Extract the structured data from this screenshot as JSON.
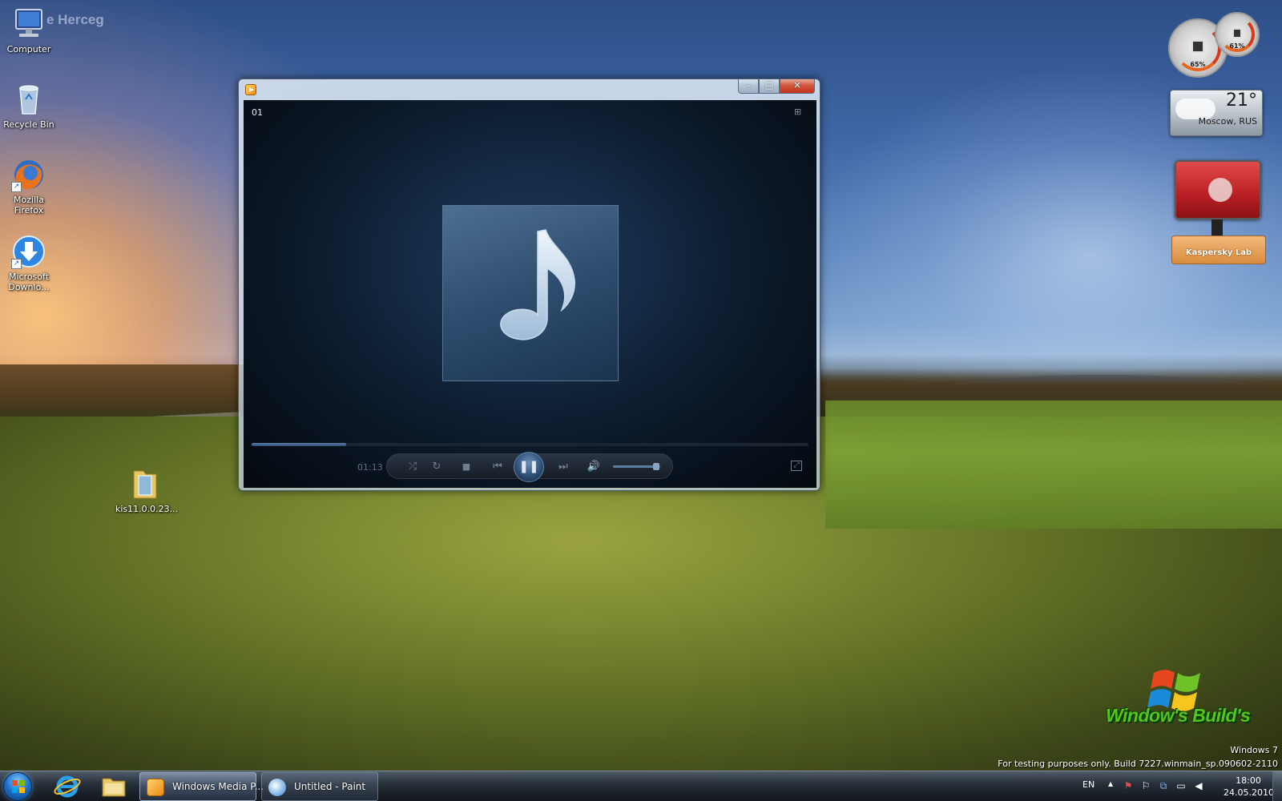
{
  "desktop": {
    "watermark_name": "e Herceg",
    "icons": [
      {
        "label": "Computer",
        "icon": "computer-icon"
      },
      {
        "label": "Recycle Bin",
        "icon": "recycle-bin-icon"
      },
      {
        "label": "Mozilla Firefox",
        "icon": "firefox-icon"
      },
      {
        "label": "Microsoft Downlo...",
        "icon": "download-icon"
      },
      {
        "label": "kis11.0.0.23...",
        "icon": "folder-icon"
      }
    ]
  },
  "media_player": {
    "track_label": "01",
    "elapsed_time": "01:13",
    "progress_fraction": 0.17,
    "volume_fraction": 0.9,
    "window_buttons": {
      "minimize": "–",
      "maximize": "□",
      "close": "✕"
    },
    "controls": {
      "shuffle": "⤮",
      "repeat": "↻",
      "stop": "■",
      "previous": "⏮",
      "play_pause": "❚❚",
      "next": "⏭",
      "mute": "🔊",
      "switch_view": "⊞",
      "fullscreen": "⤢"
    },
    "art_icon": "music-note-icon"
  },
  "gadgets": {
    "cpu_meter": {
      "cpu_percent": "65%",
      "ram_percent": "61%"
    },
    "weather": {
      "temperature": "21°",
      "location": "Moscow, RUS"
    },
    "kaspersky": {
      "label": "Kaspersky Lab"
    }
  },
  "branding": {
    "logo_text": "Window's Build's",
    "os_name": "Windows 7",
    "build_notice": "For testing purposes only. Build 7227.winmain_sp.090602-2110"
  },
  "taskbar": {
    "pinned": [
      {
        "name": "internet-explorer",
        "icon": "internet-explorer-icon"
      },
      {
        "name": "windows-explorer",
        "icon": "folder-icon"
      }
    ],
    "apps": [
      {
        "label": "Windows Media P...",
        "icon": "media-player-icon",
        "active": true
      },
      {
        "label": "Untitled - Paint",
        "icon": "paint-icon",
        "active": false
      }
    ],
    "tray": {
      "language": "EN",
      "show_hidden": "▲",
      "clock_time": "18:00",
      "clock_date": "24.05.2010"
    }
  },
  "colors": {
    "taskbar": "#1e2630",
    "accent_blue": "#1c6fc8",
    "logo_green": "#53c51e",
    "close_red": "#c3351c"
  }
}
